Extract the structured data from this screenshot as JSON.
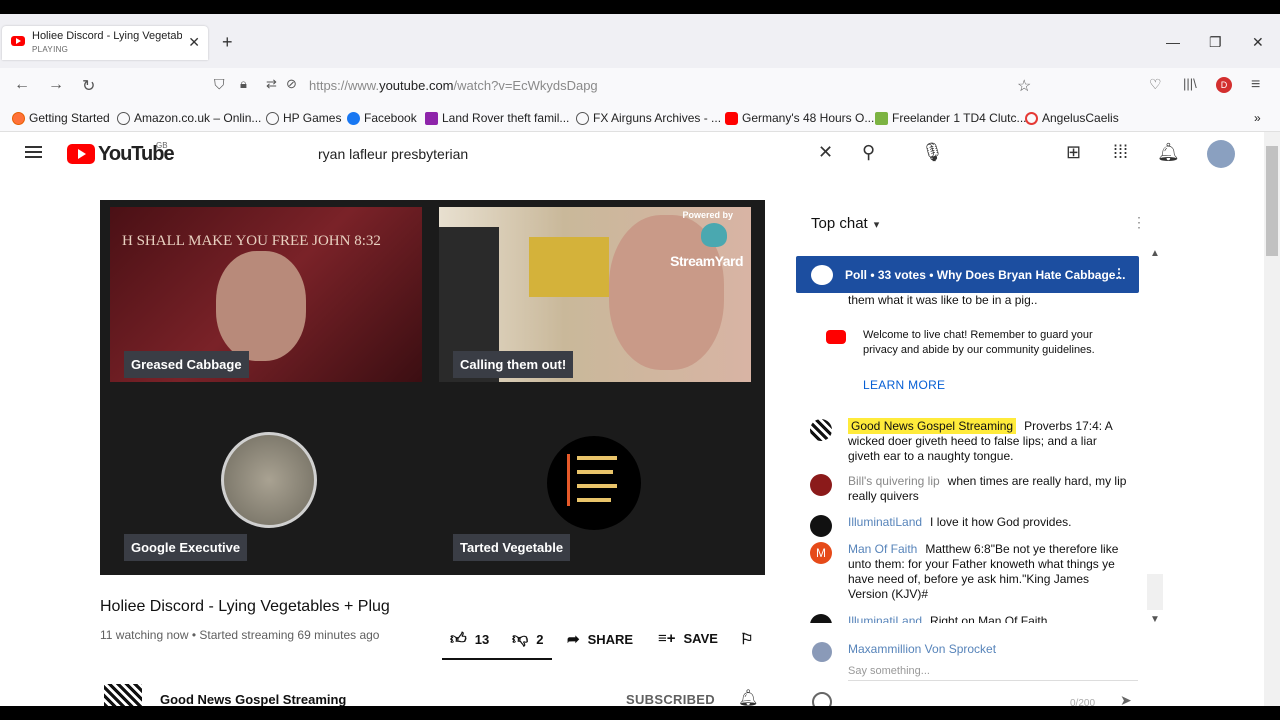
{
  "browser": {
    "tab_title": "Holiee Discord - Lying Vegetab",
    "tab_status": "PLAYING",
    "url_prefix": "https://www.",
    "url_domain": "youtube.com",
    "url_path": "/watch?v=EcWkydsDapg",
    "profile_initial": "D"
  },
  "bookmarks": [
    "Getting Started",
    "Amazon.co.uk – Onlin...",
    "HP Games",
    "Facebook",
    "Land Rover theft famil...",
    "FX Airguns Archives - ...",
    "Germany's 48 Hours O...",
    "Freelander 1 TD4 Clutc...",
    "AngelusCaelis"
  ],
  "youtube": {
    "logo_text": "YouTube",
    "region": "GB",
    "search_query": "ryan lafleur presbyterian"
  },
  "video": {
    "participants": [
      "Greased Cabbage",
      "Calling them out!",
      "Google Executive",
      "Tarted Vegetable"
    ],
    "banner_text": "H SHALL MAKE YOU FREE   JOHN 8:32",
    "powered_by": "Powered by",
    "streamyard": "StreamYard",
    "title": "Holiee Discord - Lying Vegetables + Plug",
    "meta": "11 watching now • Started streaming 69 minutes ago",
    "likes": "13",
    "dislikes": "2",
    "share_label": "SHARE",
    "save_label": "SAVE",
    "channel_name": "Good News Gospel Streaming",
    "subscribed_label": "SUBSCRIBED"
  },
  "chat": {
    "header": "Top chat",
    "poll_text": "Poll • 33 votes • Why Does Bryan Hate Cabbage...",
    "clipped_text": "them what it was like to be in a pig..",
    "welcome_text": "Welcome to live chat! Remember to guard your privacy and abide by our community guidelines.",
    "learn_more": "LEARN MORE",
    "messages": [
      {
        "author": "Good News Gospel Streaming",
        "text": "Proverbs 17:4: A wicked doer giveth heed to false lips; and a liar giveth ear to a naughty tongue."
      },
      {
        "author": "Bill's quivering lip",
        "text": "when times are really hard, my lip really quivers"
      },
      {
        "author": "IlluminatiLand",
        "text": "I love it how God provides."
      },
      {
        "author": "Man Of Faith",
        "avatar_letter": "M",
        "text": "Matthew 6:8\"Be not ye therefore like unto them: for your Father knoweth what things ye have need of, before ye ask him.\"King James Version (KJV)#"
      },
      {
        "author": "IlluminatiLand",
        "text": "Right on Man Of Faith"
      }
    ],
    "input_user": "Maxammillion Von Sprocket",
    "input_placeholder": "Say something...",
    "char_counter": "0/200"
  }
}
